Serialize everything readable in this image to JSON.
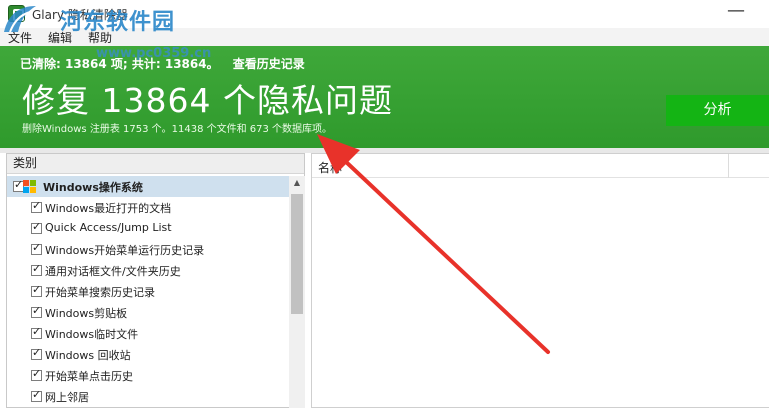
{
  "window": {
    "title": "Glary 隐私清除器",
    "minimize_glyph": "—"
  },
  "watermark": {
    "site_name": "河东软件园",
    "url": "www.pc0359.cn"
  },
  "menu": {
    "items": [
      "文件",
      "编辑",
      "帮助"
    ]
  },
  "banner": {
    "summary": "已清除: 13864 项; 共计: 13864。",
    "history_link": "查看历史记录",
    "headline": "修复 13864 个隐私问题",
    "subline": "删除Windows 注册表 1753 个。11438 个文件和 673 个数据库项。",
    "analyze_label": "分析"
  },
  "left_panel": {
    "header": "类别",
    "group_label": "Windows操作系统",
    "items": [
      {
        "label": "Windows最近打开的文档",
        "checked": true
      },
      {
        "label": "Quick Access/Jump List",
        "checked": true
      },
      {
        "label": "Windows开始菜单运行历史记录",
        "checked": true
      },
      {
        "label": "通用对话框文件/文件夹历史",
        "checked": true
      },
      {
        "label": "开始菜单搜索历史记录",
        "checked": true
      },
      {
        "label": "Windows剪贴板",
        "checked": true
      },
      {
        "label": "Windows临时文件",
        "checked": true
      },
      {
        "label": "Windows 回收站",
        "checked": true
      },
      {
        "label": "开始菜单点击历史",
        "checked": true
      },
      {
        "label": "网上邻居",
        "checked": true
      }
    ]
  },
  "right_panel": {
    "column_name": "名称"
  },
  "colors": {
    "banner_green": "#3fa83a",
    "analyze_button": "#14b414",
    "arrow_red": "#e8322a",
    "watermark_blue": "#2a87c9"
  }
}
